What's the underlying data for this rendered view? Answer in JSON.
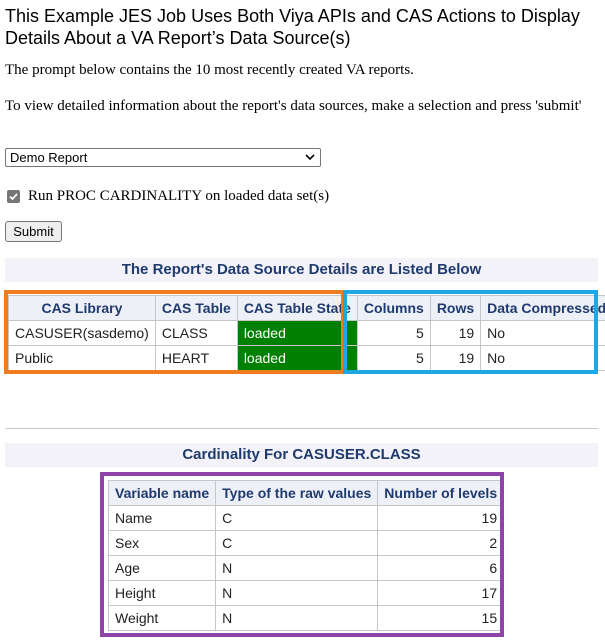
{
  "header": {
    "title": "This Example JES Job Uses Both Viya APIs and CAS Actions to Display Details About a VA Report’s Data Source(s)",
    "intro": "The prompt below contains the 10 most recently created VA reports.",
    "instructions": "To view detailed information about the report's data sources, make a selection and press 'submit'"
  },
  "form": {
    "report_select_value": "Demo Report",
    "cardinality_checkbox_label": "Run PROC CARDINALITY on loaded data set(s)",
    "cardinality_checked": true,
    "submit_label": "Submit"
  },
  "datasources": {
    "caption": "The Report's Data Source Details are Listed Below",
    "columns": [
      "CAS Library",
      "CAS Table",
      "CAS Table State",
      "Columns",
      "Rows",
      "Data Compressed?"
    ],
    "rows": [
      [
        "CASUSER(sasdemo)",
        "CLASS",
        "loaded",
        "5",
        "19",
        "No"
      ],
      [
        "Public",
        "HEART",
        "loaded",
        "5",
        "19",
        "No"
      ]
    ],
    "state_color": "#008000"
  },
  "cardinality": {
    "caption": "Cardinality For CASUSER.CLASS",
    "columns": [
      "Variable name",
      "Type of the raw values",
      "Number of levels"
    ],
    "rows": [
      [
        "Name",
        "C",
        "19"
      ],
      [
        "Sex",
        "C",
        "2"
      ],
      [
        "Age",
        "N",
        "6"
      ],
      [
        "Height",
        "N",
        "17"
      ],
      [
        "Weight",
        "N",
        "15"
      ]
    ]
  },
  "highlight_colors": {
    "orange": "#f07d1c",
    "blue": "#1ea7e0",
    "purple": "#8e44a7"
  }
}
